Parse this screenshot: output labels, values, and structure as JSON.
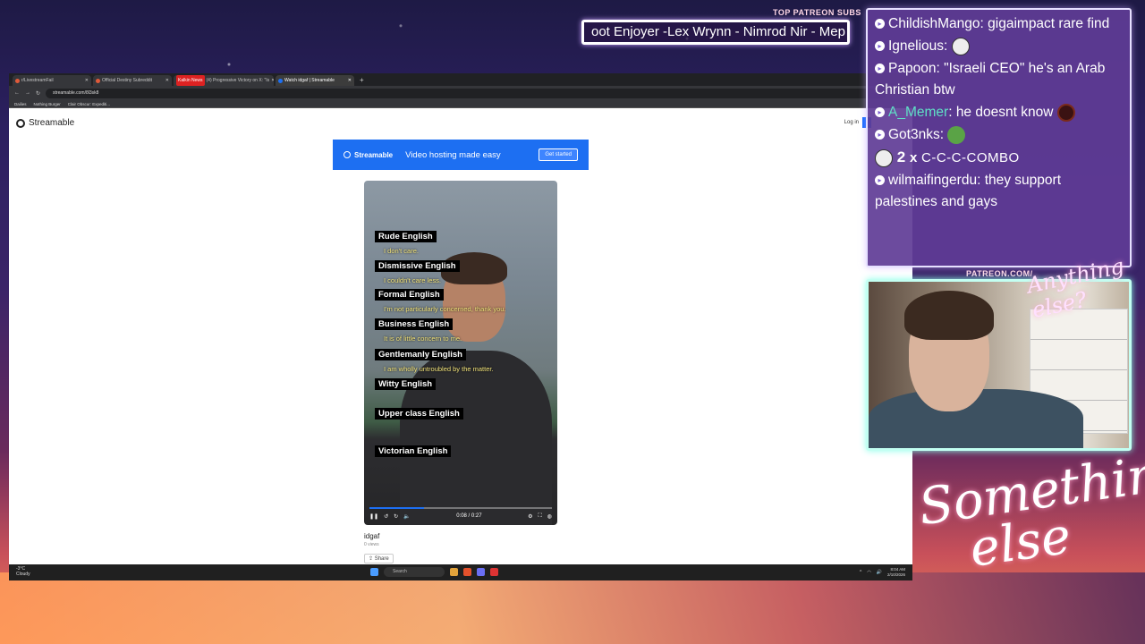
{
  "overlay": {
    "patreon_title": "TOP PATREON SUBS",
    "ticker_text": "oot Enjoyer -Lex Wrynn - Nimrod Nir - Mep",
    "patreon_url": "PATREON.COM/",
    "script_small": "Anything else?",
    "script_big_line1": "Something",
    "script_big_line2": "else"
  },
  "browser": {
    "tabs": [
      {
        "label": "r/LivestreamFail",
        "active": false
      },
      {
        "label": "Official Destiny Subreddit",
        "active": false
      },
      {
        "label": "(4) Progressive Victory on X: \"Is",
        "badge": "Kalkin News",
        "active": false
      },
      {
        "label": "Watch idgaf | Streamable",
        "active": true
      }
    ],
    "new_tab": "+",
    "url": "streamable.com/8l3sk8",
    "bookmarks": [
      "Dailies",
      "Nothing Burger",
      "Clair Obscur: Expediti..."
    ]
  },
  "page": {
    "logo_text": "Streamable",
    "login_label": "Log in",
    "banner": {
      "logo": "Streamable",
      "text": "Video hosting made easy",
      "button": "Get started"
    },
    "video": {
      "captions": [
        {
          "label": "Rude English",
          "sub": "I don't care."
        },
        {
          "label": "Dismissive English",
          "sub": "I couldn't care less."
        },
        {
          "label": "Formal English",
          "sub": "I'm not particularly concerned, thank you."
        },
        {
          "label": "Business English",
          "sub": "It is of little concern to me."
        },
        {
          "label": "Gentlemanly English",
          "sub": "I am wholly untroubled by the matter."
        },
        {
          "label": "Witty English",
          "sub": ""
        },
        {
          "label": "Upper class English",
          "sub": ""
        },
        {
          "label": "Victorian English",
          "sub": ""
        }
      ],
      "time": "0:08 / 0:27",
      "progress": 0.3
    },
    "title": "idgaf",
    "views": "0 views",
    "share": "Share"
  },
  "taskbar": {
    "weather_temp": "-3°C",
    "weather_desc": "Cloudy",
    "search": "Search",
    "time": "8:04 AM",
    "date": "2/10/2026"
  },
  "chat": {
    "messages": [
      {
        "user": "ChildishMango",
        "text": "gigaimpact rare find",
        "emote": ""
      },
      {
        "user": "Ignelious",
        "text": "",
        "emote": "face"
      },
      {
        "user": "Papoon",
        "text": "\"Israeli CEO\" he's an Arab Christian btw",
        "emote": ""
      },
      {
        "user": "A_Memer",
        "text": "he doesnt know",
        "emote": "dark"
      },
      {
        "user": "Got3nks",
        "text": "",
        "emote": "frog"
      }
    ],
    "combo_count": "2",
    "combo_x": "x",
    "combo_text": "C-C-C-COMBO",
    "last": {
      "user": "wilmaifingerdu",
      "text": "they support palestines and gays"
    }
  }
}
